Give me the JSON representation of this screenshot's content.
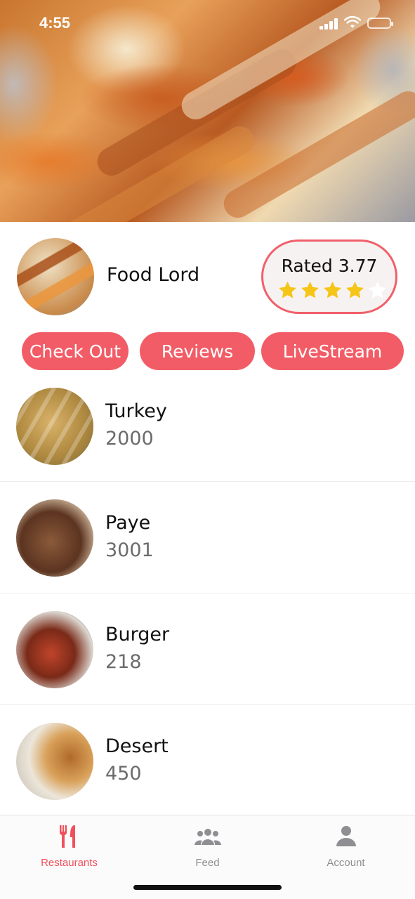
{
  "status_bar": {
    "time": "4:55"
  },
  "restaurant": {
    "name": "Food Lord",
    "rating_label": "Rated 3.77",
    "rating": 3.77,
    "stars_max": 5
  },
  "actions": {
    "checkout": "Check Out",
    "reviews": "Reviews",
    "livestream": "LiveStream"
  },
  "menu": {
    "items": [
      {
        "name": "Turkey",
        "price": "2000"
      },
      {
        "name": "Paye",
        "price": "3001"
      },
      {
        "name": "Burger",
        "price": "218"
      },
      {
        "name": "Desert",
        "price": "450"
      }
    ]
  },
  "tabbar": {
    "tabs": [
      {
        "label": "Restaurants",
        "icon": "fork-knife-icon",
        "active": true
      },
      {
        "label": "Feed",
        "icon": "people-icon",
        "active": false
      },
      {
        "label": "Account",
        "icon": "person-icon",
        "active": false
      }
    ]
  },
  "colors": {
    "accent": "#f25c66",
    "star": "#f5c518",
    "active_tab": "#f0505c",
    "inactive_tab": "#8e8e93"
  }
}
